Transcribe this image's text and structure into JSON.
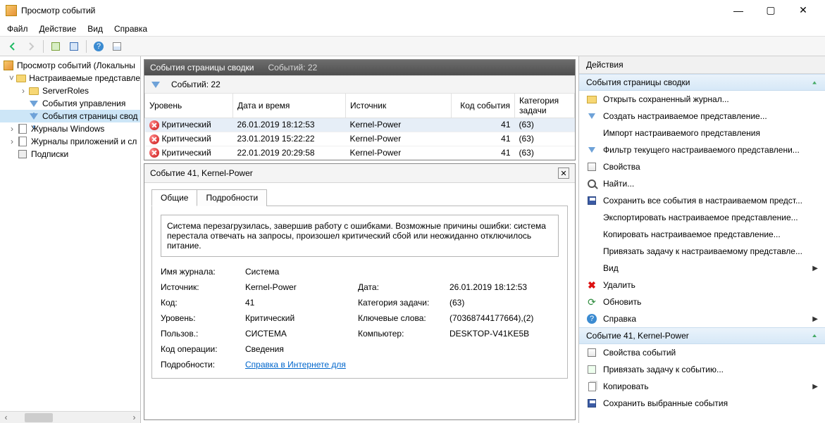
{
  "window": {
    "title": "Просмотр событий"
  },
  "winbuttons": {
    "min": "—",
    "max": "▢",
    "close": "✕"
  },
  "menu": [
    "Файл",
    "Действие",
    "Вид",
    "Справка"
  ],
  "tree": {
    "root": "Просмотр событий (Локальны",
    "custom": "Настраиваемые представле",
    "serverRoles": "ServerRoles",
    "mgmt": "События управления",
    "summary": "События страницы свод",
    "winLogs": "Журналы Windows",
    "appLogs": "Журналы приложений и сл",
    "subs": "Подписки"
  },
  "centerHeader": {
    "title": "События страницы сводки",
    "count": "Событий: 22"
  },
  "filterRow": {
    "count": "Событий: 22"
  },
  "grid": {
    "cols": [
      "Уровень",
      "Дата и время",
      "Источник",
      "Код события",
      "Категория задачи"
    ],
    "rows": [
      {
        "level": "Критический",
        "date": "26.01.2019 18:12:53",
        "source": "Kernel-Power",
        "id": "41",
        "cat": "(63)"
      },
      {
        "level": "Критический",
        "date": "23.01.2019 15:22:22",
        "source": "Kernel-Power",
        "id": "41",
        "cat": "(63)"
      },
      {
        "level": "Критический",
        "date": "22.01.2019 20:29:58",
        "source": "Kernel-Power",
        "id": "41",
        "cat": "(63)"
      }
    ]
  },
  "detail": {
    "header": "Событие 41, Kernel-Power",
    "tabs": {
      "general": "Общие",
      "details": "Подробности"
    },
    "message": "Система перезагрузилась, завершив работу с ошибками. Возможные причины ошибки: система перестала отвечать на запросы, произошел критический сбой или неожиданно отключилось питание.",
    "fields": {
      "logNameL": "Имя журнала:",
      "logNameV": "Система",
      "sourceL": "Источник:",
      "sourceV": "Kernel-Power",
      "dateL": "Дата:",
      "dateV": "26.01.2019 18:12:53",
      "codeL": "Код:",
      "codeV": "41",
      "catL": "Категория задачи:",
      "catV": "(63)",
      "levelL": "Уровень:",
      "levelV": "Критический",
      "keywordsL": "Ключевые слова:",
      "keywordsV": "(70368744177664),(2)",
      "userL": "Пользов.:",
      "userV": "СИСТЕМА",
      "computerL": "Компьютер:",
      "computerV": "DESKTOP-V41KE5B",
      "opcodeL": "Код операции:",
      "opcodeV": "Сведения",
      "moreL": "Подробности:",
      "moreV": "Справка в Интернете для"
    }
  },
  "actions": {
    "title": "Действия",
    "section1": "События страницы сводки",
    "items1": [
      "Открыть сохраненный журнал...",
      "Создать настраиваемое представление...",
      "Импорт настраиваемого представления",
      "Фильтр текущего настраиваемого представлени...",
      "Свойства",
      "Найти...",
      "Сохранить все события в настраиваемом предст...",
      "Экспортировать настраиваемое представление...",
      "Копировать настраиваемое представление...",
      "Привязать задачу к настраиваемому представле...",
      "Вид",
      "Удалить",
      "Обновить",
      "Справка"
    ],
    "section2": "Событие 41, Kernel-Power",
    "items2": [
      "Свойства событий",
      "Привязать задачу к событию...",
      "Копировать",
      "Сохранить выбранные события"
    ]
  }
}
